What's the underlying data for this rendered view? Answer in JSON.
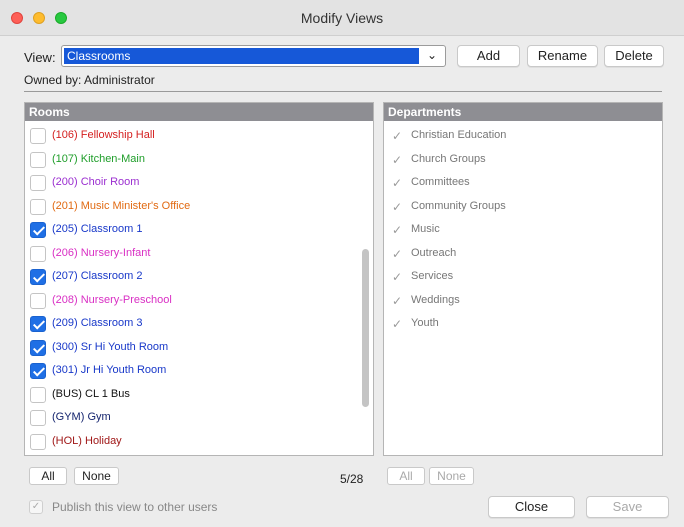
{
  "window": {
    "title": "Modify Views"
  },
  "view": {
    "label": "View:",
    "selected": "Classrooms"
  },
  "toolbar": {
    "add_label": "Add",
    "rename_label": "Rename",
    "delete_label": "Delete"
  },
  "owner": {
    "label": "Owned by:",
    "name": "Administrator"
  },
  "rooms": {
    "header": "Rooms",
    "items": [
      {
        "label": "(106) Fellowship Hall",
        "color": "#d41f1f",
        "checked": false
      },
      {
        "label": "(107) Kitchen-Main",
        "color": "#1f9e2a",
        "checked": false
      },
      {
        "label": "(200) Choir Room",
        "color": "#9b2fd0",
        "checked": false
      },
      {
        "label": "(201) Music Minister's Office",
        "color": "#e16a12",
        "checked": false
      },
      {
        "label": "(205) Classroom 1",
        "color": "#1838c9",
        "checked": true
      },
      {
        "label": "(206) Nursery-Infant",
        "color": "#d92fc4",
        "checked": false
      },
      {
        "label": "(207) Classroom 2",
        "color": "#1838c9",
        "checked": true
      },
      {
        "label": "(208) Nursery-Preschool",
        "color": "#d92fc4",
        "checked": false
      },
      {
        "label": "(209) Classroom 3",
        "color": "#1838c9",
        "checked": true
      },
      {
        "label": "(300) Sr Hi Youth Room",
        "color": "#1838c9",
        "checked": true
      },
      {
        "label": "(301) Jr Hi Youth Room",
        "color": "#1838c9",
        "checked": true
      },
      {
        "label": "(BUS) CL 1 Bus",
        "color": "#111111",
        "checked": false
      },
      {
        "label": "(GYM) Gym",
        "color": "#14246e",
        "checked": false
      },
      {
        "label": "(HOL) Holiday",
        "color": "#a01818",
        "checked": false
      }
    ],
    "all_label": "All",
    "none_label": "None",
    "count": "5/28"
  },
  "departments": {
    "header": "Departments",
    "items": [
      {
        "label": "Christian Education"
      },
      {
        "label": "Church Groups"
      },
      {
        "label": "Committees"
      },
      {
        "label": "Community Groups"
      },
      {
        "label": "Music"
      },
      {
        "label": "Outreach"
      },
      {
        "label": "Services"
      },
      {
        "label": "Weddings"
      },
      {
        "label": "Youth"
      }
    ],
    "all_label": "All",
    "none_label": "None"
  },
  "publish": {
    "label": "Publish this view to other users",
    "checked": true
  },
  "footer": {
    "close_label": "Close",
    "save_label": "Save"
  },
  "icons": {
    "close": "close-window-icon",
    "minimize": "minimize-window-icon",
    "maximize": "zoom-window-icon",
    "dropdown": "chevron-down-icon",
    "check": "checkmark-icon"
  }
}
